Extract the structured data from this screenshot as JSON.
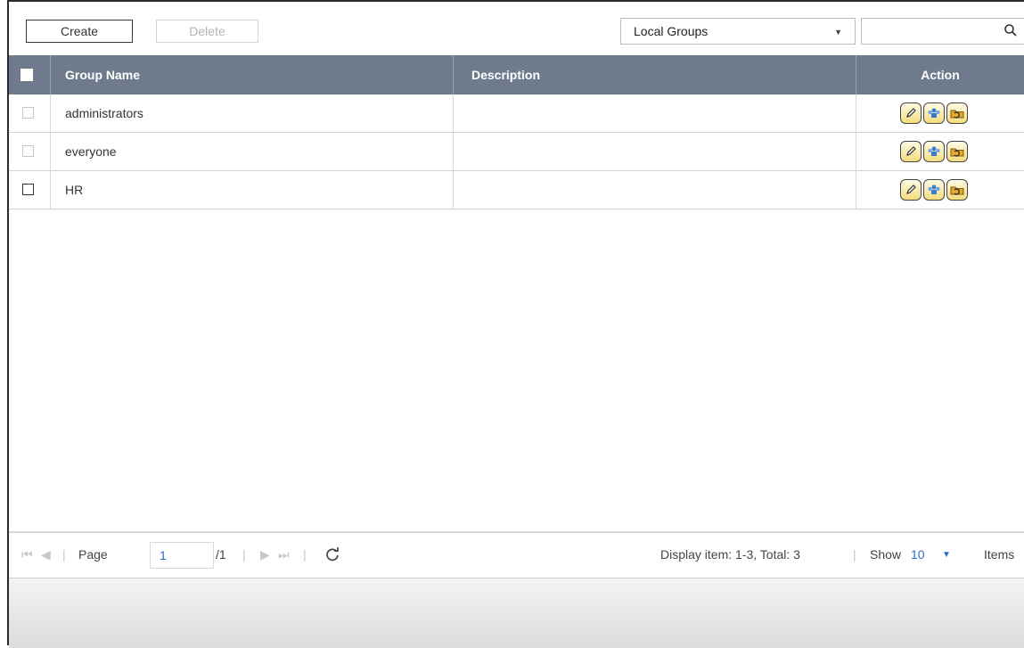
{
  "toolbar": {
    "create_label": "Create",
    "delete_label": "Delete",
    "group_type_selected": "Local Groups",
    "search_placeholder": ""
  },
  "table": {
    "columns": [
      "Group Name",
      "Description",
      "Action"
    ],
    "rows": [
      {
        "name": "administrators",
        "description": "",
        "checked": false
      },
      {
        "name": "everyone",
        "description": "",
        "checked": false
      },
      {
        "name": "HR",
        "description": "",
        "checked": false
      }
    ],
    "row_actions": [
      "edit-icon",
      "group-users-icon",
      "folder-permission-icon"
    ]
  },
  "pager": {
    "page_label": "Page",
    "page_value": "1",
    "total_pages": "/1",
    "display_info": "Display item: 1-3, Total: 3",
    "show_label": "Show",
    "items_per_page": "10",
    "items_label": "Items"
  },
  "colors": {
    "header_bg": "#6f7b8d",
    "accent": "#2a6fc9",
    "action_icon_fill": "#f4dd7c"
  }
}
